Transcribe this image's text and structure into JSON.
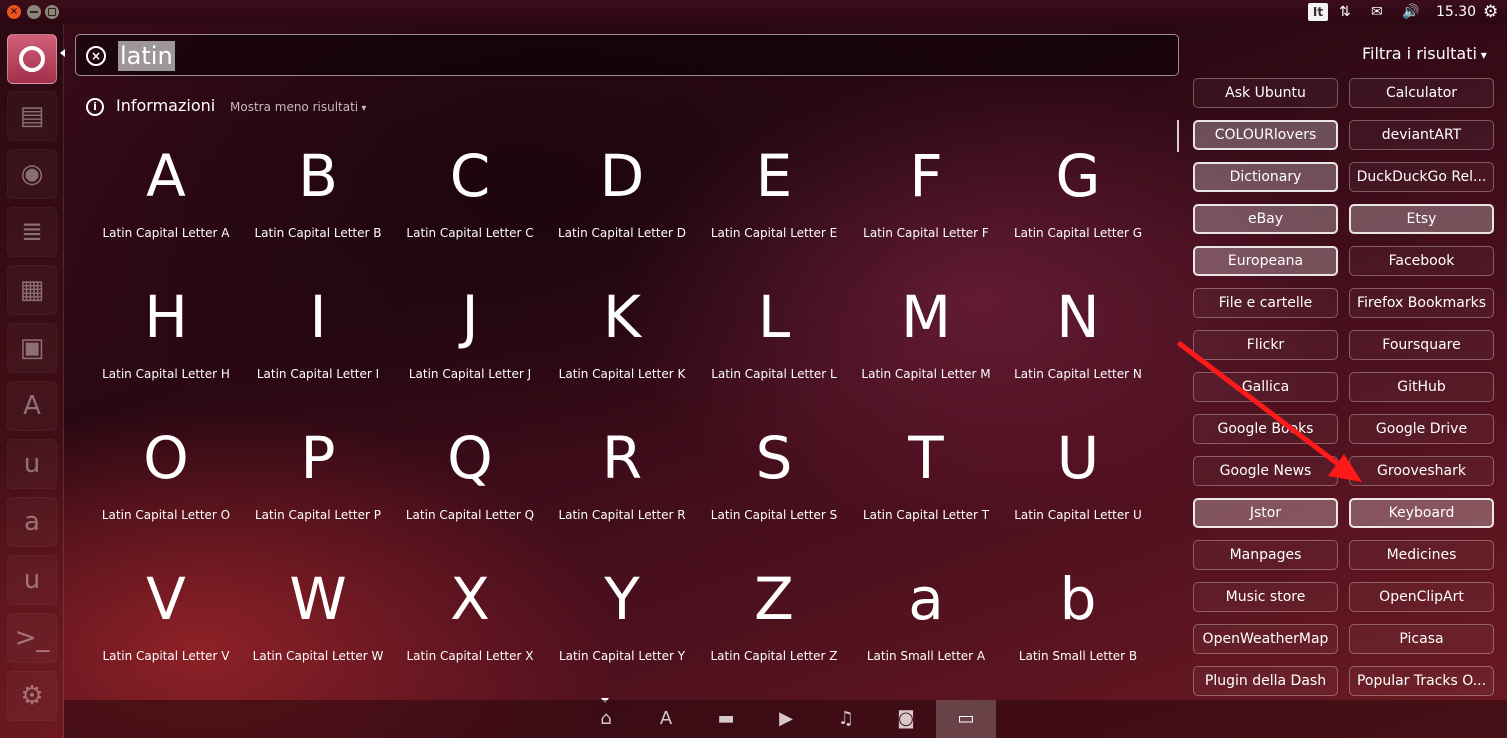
{
  "top_panel": {
    "close_glyph": "×",
    "keyboard_layout": "It",
    "network_glyph": "⇅",
    "mail_glyph": "✉",
    "volume_glyph": "🔊",
    "clock": "15.30",
    "session_glyph": "⚙"
  },
  "launcher": {
    "items": [
      {
        "icon": "files-icon",
        "glyph": "▤"
      },
      {
        "icon": "firefox-icon",
        "glyph": "◉"
      },
      {
        "icon": "writer-icon",
        "glyph": "≣"
      },
      {
        "icon": "calc-icon",
        "glyph": "▦"
      },
      {
        "icon": "impress-icon",
        "glyph": "▣"
      },
      {
        "icon": "software-center-icon",
        "glyph": "A"
      },
      {
        "icon": "ubuntu-one-icon",
        "glyph": "u"
      },
      {
        "icon": "amazon-icon",
        "glyph": "a"
      },
      {
        "icon": "ubuntu-one-music-icon",
        "glyph": "u"
      },
      {
        "icon": "terminal-icon",
        "glyph": ">_"
      },
      {
        "icon": "settings-icon",
        "glyph": "⚙"
      }
    ]
  },
  "search": {
    "query": "latin",
    "clear_glyph": "×"
  },
  "category": {
    "info_glyph": "i",
    "title": "Informazioni",
    "toggle": "Mostra meno risultati"
  },
  "results": [
    {
      "glyph": "A",
      "label": "Latin Capital Letter A"
    },
    {
      "glyph": "B",
      "label": "Latin Capital Letter B"
    },
    {
      "glyph": "C",
      "label": "Latin Capital Letter C"
    },
    {
      "glyph": "D",
      "label": "Latin Capital Letter D"
    },
    {
      "glyph": "E",
      "label": "Latin Capital Letter E"
    },
    {
      "glyph": "F",
      "label": "Latin Capital Letter F"
    },
    {
      "glyph": "G",
      "label": "Latin Capital Letter G"
    },
    {
      "glyph": "H",
      "label": "Latin Capital Letter H"
    },
    {
      "glyph": "I",
      "label": "Latin Capital Letter I"
    },
    {
      "glyph": "J",
      "label": "Latin Capital Letter J"
    },
    {
      "glyph": "K",
      "label": "Latin Capital Letter K"
    },
    {
      "glyph": "L",
      "label": "Latin Capital Letter L"
    },
    {
      "glyph": "M",
      "label": "Latin Capital Letter M"
    },
    {
      "glyph": "N",
      "label": "Latin Capital Letter N"
    },
    {
      "glyph": "O",
      "label": "Latin Capital Letter O"
    },
    {
      "glyph": "P",
      "label": "Latin Capital Letter P"
    },
    {
      "glyph": "Q",
      "label": "Latin Capital Letter Q"
    },
    {
      "glyph": "R",
      "label": "Latin Capital Letter R"
    },
    {
      "glyph": "S",
      "label": "Latin Capital Letter S"
    },
    {
      "glyph": "T",
      "label": "Latin Capital Letter T"
    },
    {
      "glyph": "U",
      "label": "Latin Capital Letter U"
    },
    {
      "glyph": "V",
      "label": "Latin Capital Letter V"
    },
    {
      "glyph": "W",
      "label": "Latin Capital Letter W"
    },
    {
      "glyph": "X",
      "label": "Latin Capital Letter X"
    },
    {
      "glyph": "Y",
      "label": "Latin Capital Letter Y"
    },
    {
      "glyph": "Z",
      "label": "Latin Capital Letter Z"
    },
    {
      "glyph": "a",
      "label": "Latin Small Letter A"
    },
    {
      "glyph": "b",
      "label": "Latin Small Letter B"
    }
  ],
  "filters": {
    "header": "Filtra i risultati",
    "items": [
      {
        "label": "Ask Ubuntu",
        "active": false
      },
      {
        "label": "Calculator",
        "active": false
      },
      {
        "label": "COLOURlovers",
        "active": true
      },
      {
        "label": "deviantART",
        "active": false
      },
      {
        "label": "Dictionary",
        "active": true
      },
      {
        "label": "DuckDuckGo Rel...",
        "active": false
      },
      {
        "label": "eBay",
        "active": true
      },
      {
        "label": "Etsy",
        "active": true
      },
      {
        "label": "Europeana",
        "active": true
      },
      {
        "label": "Facebook",
        "active": false
      },
      {
        "label": "File e cartelle",
        "active": false
      },
      {
        "label": "Firefox Bookmarks",
        "active": false
      },
      {
        "label": "Flickr",
        "active": false
      },
      {
        "label": "Foursquare",
        "active": false
      },
      {
        "label": "Gallica",
        "active": false
      },
      {
        "label": "GitHub",
        "active": false
      },
      {
        "label": "Google Books",
        "active": false
      },
      {
        "label": "Google Drive",
        "active": false
      },
      {
        "label": "Google News",
        "active": false
      },
      {
        "label": "Grooveshark",
        "active": false
      },
      {
        "label": "Jstor",
        "active": true
      },
      {
        "label": "Keyboard",
        "active": true
      },
      {
        "label": "Manpages",
        "active": false
      },
      {
        "label": "Medicines",
        "active": false
      },
      {
        "label": "Music store",
        "active": false
      },
      {
        "label": "OpenClipArt",
        "active": false
      },
      {
        "label": "OpenWeatherMap",
        "active": false
      },
      {
        "label": "Picasa",
        "active": false
      },
      {
        "label": "Plugin della Dash",
        "active": false
      },
      {
        "label": "Popular Tracks O...",
        "active": false
      }
    ]
  },
  "lenses": [
    {
      "icon": "home-lens-icon",
      "glyph": "⌂",
      "active": false
    },
    {
      "icon": "applications-lens-icon",
      "glyph": "A",
      "active": false
    },
    {
      "icon": "files-lens-icon",
      "glyph": "▬",
      "active": false
    },
    {
      "icon": "video-lens-icon",
      "glyph": "▶",
      "active": false
    },
    {
      "icon": "music-lens-icon",
      "glyph": "♫",
      "active": false
    },
    {
      "icon": "photo-lens-icon",
      "glyph": "◙",
      "active": false
    },
    {
      "icon": "social-lens-icon",
      "glyph": "▭",
      "active": true
    }
  ],
  "colors": {
    "accent": "#e95420",
    "annotation_arrow": "#ff1a1a"
  }
}
